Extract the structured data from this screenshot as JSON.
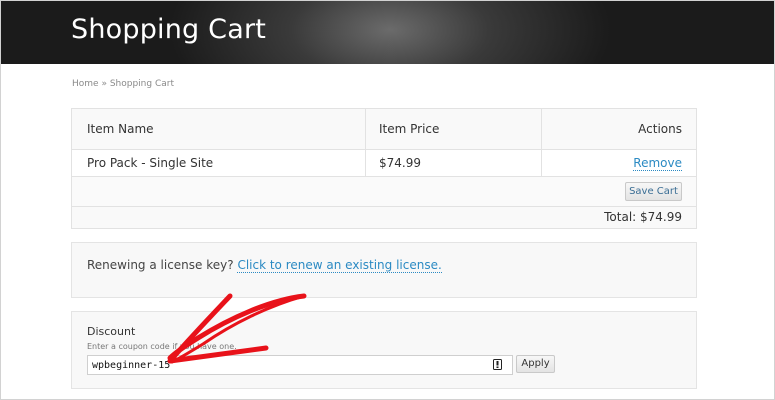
{
  "header": {
    "title": "Shopping Cart"
  },
  "breadcrumb": {
    "home": "Home",
    "separator": " » ",
    "current": "Shopping Cart"
  },
  "cart": {
    "columns": {
      "item_name": "Item Name",
      "item_price": "Item Price",
      "actions": "Actions"
    },
    "items": [
      {
        "name": "Pro Pack - Single Site",
        "price": "$74.99",
        "action": "Remove"
      }
    ],
    "save_button": "Save Cart",
    "total": "Total: $74.99"
  },
  "renew": {
    "text": "Renewing a license key?",
    "link": "Click to renew an existing license."
  },
  "discount": {
    "title": "Discount",
    "hint": "Enter a coupon code if you have one.",
    "input_value": "wpbeginner-15",
    "apply_button": "Apply"
  },
  "colors": {
    "link": "#2b8ac3",
    "annotation_arrow": "#e8121a",
    "header_bg": "#2a2a2a"
  },
  "icons": {
    "input_key": "password-key-icon"
  }
}
